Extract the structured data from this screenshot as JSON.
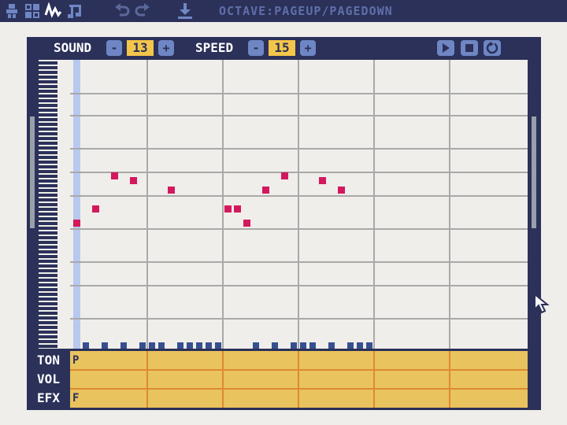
{
  "toolbar": {
    "hint": "OCTAVE:PAGEUP/PAGEDOWN",
    "icons": [
      "image-editor-icon",
      "tilemap-editor-icon",
      "sound-editor-icon",
      "music-editor-icon",
      "undo-icon",
      "redo-icon",
      "export-icon"
    ]
  },
  "controls": {
    "sound_label": "SOUND",
    "sound_value": "13",
    "speed_label": "SPEED",
    "speed_value": "15",
    "minus": "-",
    "plus": "+"
  },
  "lanes": {
    "tone_label": "TON",
    "volume_label": "VOL",
    "effect_label": "EFX",
    "tone_first": "P",
    "volume_first": "",
    "effect_first": "F"
  },
  "colors": {
    "frame": "#2b3159",
    "note": "#d4185e",
    "value_box": "#f3c54a",
    "lane_fill": "#e9c35e",
    "playhead": "#b8c9ef"
  }
}
